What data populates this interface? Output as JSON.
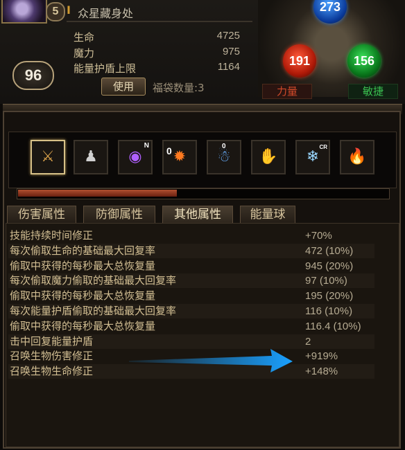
{
  "header": {
    "portrait_level": "5",
    "location": "众星藏身处",
    "character_level": "96",
    "use_button": "使用",
    "bag_count": "福袋数量:3"
  },
  "vitals": [
    {
      "label": "生命",
      "value": "4725"
    },
    {
      "label": "魔力",
      "value": "975"
    },
    {
      "label": "能量护盾上限",
      "value": "1164"
    }
  ],
  "attributes": {
    "intelligence": "273",
    "strength": "191",
    "dexterity": "156",
    "strength_label": "力量",
    "dexterity_label": "敏捷"
  },
  "skills": [
    {
      "icon": "dagger-icon",
      "tag": ""
    },
    {
      "icon": "armor-silhouette-icon",
      "tag": ""
    },
    {
      "icon": "purple-vortex-icon",
      "tag": "N"
    },
    {
      "icon": "fire-spell-icon",
      "tag": "0"
    },
    {
      "icon": "blue-orb-figure-icon",
      "tag": "0"
    },
    {
      "icon": "flame-hand-icon",
      "tag": ""
    },
    {
      "icon": "ice-figure-icon",
      "tag": "CR"
    },
    {
      "icon": "flame-figure-icon",
      "tag": ""
    }
  ],
  "progress": 0.43,
  "tabs": [
    {
      "label": "伤害属性",
      "active": false
    },
    {
      "label": "防御属性",
      "active": false
    },
    {
      "label": "其他属性",
      "active": true
    },
    {
      "label": "能量球",
      "active": false
    }
  ],
  "stats": [
    {
      "label": "技能持续时间修正",
      "value": "+70%"
    },
    {
      "label": "每次偷取生命的基础最大回复率",
      "value": "472 (10%)"
    },
    {
      "label": "偷取中获得的每秒最大总恢复量",
      "value": "945 (20%)"
    },
    {
      "label": "每次偷取魔力偷取的基础最大回复率",
      "value": "97 (10%)"
    },
    {
      "label": "偷取中获得的每秒最大总恢复量",
      "value": "195 (20%)"
    },
    {
      "label": "每次能量护盾偷取的基础最大回复率",
      "value": "116 (10%)"
    },
    {
      "label": "偷取中获得的每秒最大总恢复量",
      "value": "116.4 (10%)"
    },
    {
      "label": "击中回复能量护盾",
      "value": "2"
    },
    {
      "label": "召唤生物伤害修正",
      "value": "+919%"
    },
    {
      "label": "召唤生物生命修正",
      "value": "+148%"
    }
  ],
  "colors": {
    "accent_gold": "#d6c087",
    "strength_red": "#d24a2a",
    "dexterity_green": "#3ac050",
    "intelligence_blue": "#4aa0ff",
    "arrow_blue": "#1aa0ff"
  }
}
